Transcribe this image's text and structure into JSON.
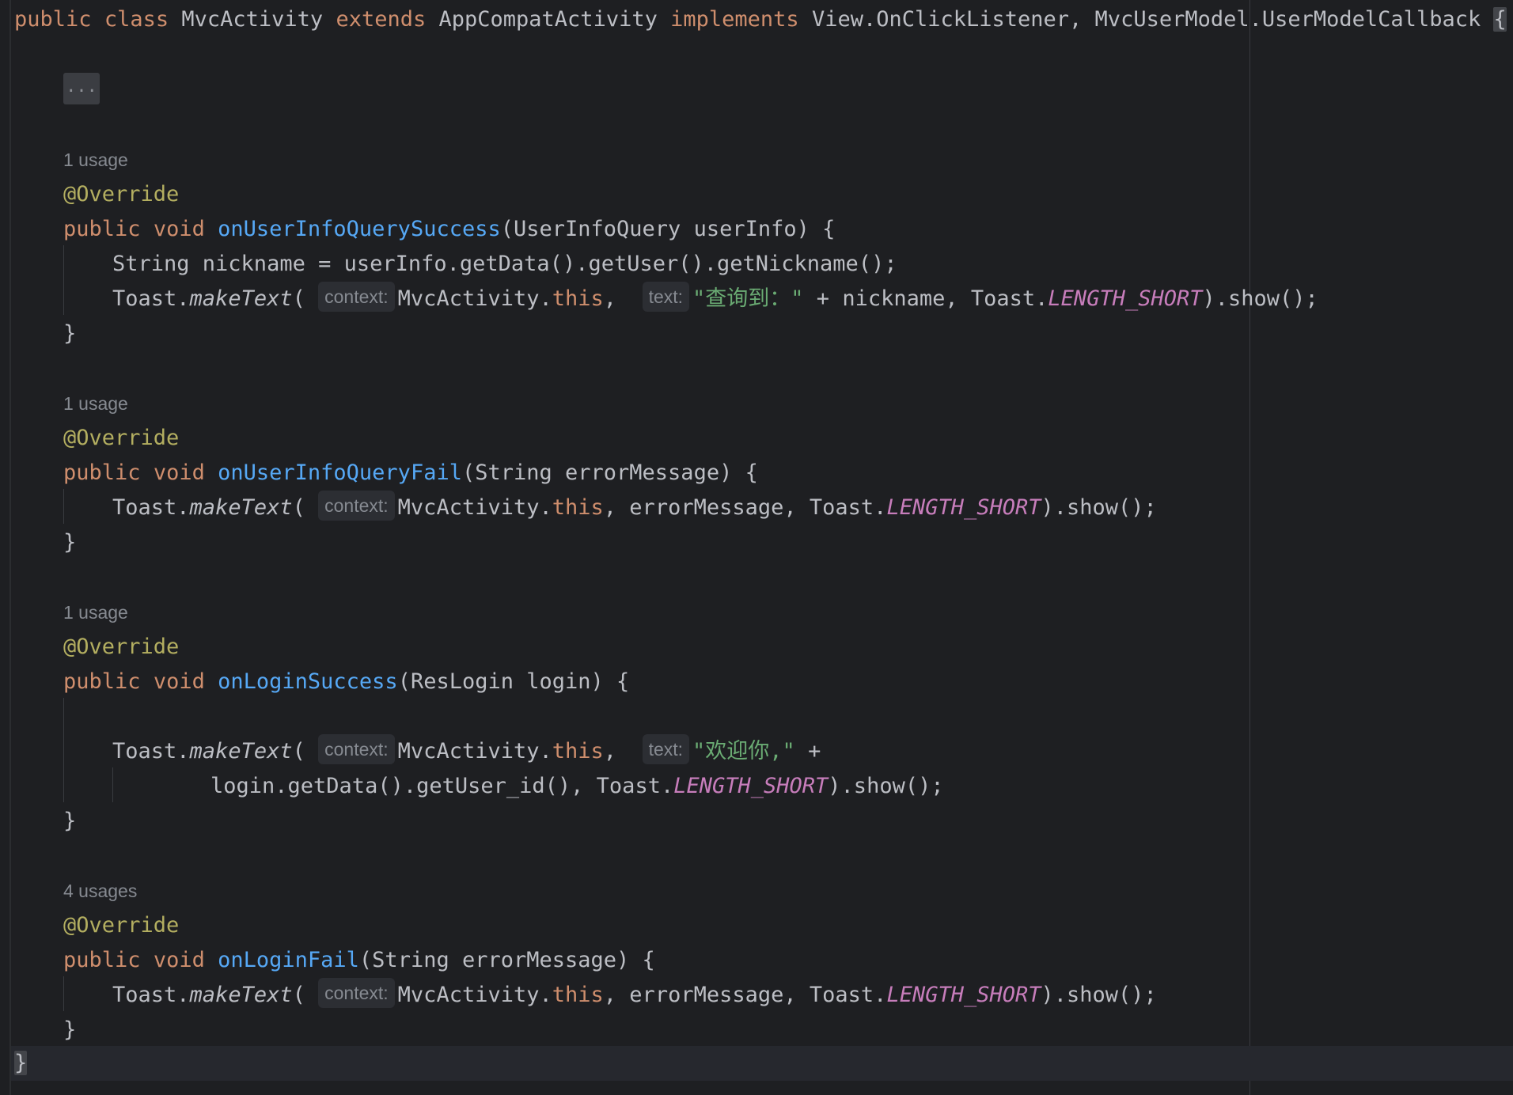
{
  "class_decl": {
    "kw_public": "public",
    "kw_class": "class",
    "class_name": "MvcActivity",
    "kw_extends": "extends",
    "super_class": "AppCompatActivity",
    "kw_implements": "implements",
    "interfaces": "View.OnClickListener, MvcUserModel.UserModelCallback",
    "open_brace": "{"
  },
  "folded_region": "...",
  "common": {
    "override": "@Override",
    "kw_public": "public",
    "kw_void": "void",
    "close_brace": "}",
    "toast": "Toast.",
    "make_text": "makeText",
    "open_paren": "(",
    "hint_context": "context:",
    "hint_text": "text:",
    "activity": "MvcActivity.",
    "kw_this": "this",
    "comma": ",",
    "toast_dot": "Toast.",
    "length_short": "LENGTH_SHORT",
    "show": ").show();"
  },
  "methods": [
    {
      "usage": "1 usage",
      "name": "onUserInfoQuerySuccess",
      "params": "(UserInfoQuery userInfo) {",
      "line1": "String nickname = userInfo.getData().getUser().getNickname();",
      "string_literal": "\"查询到：\"",
      "after_string": " + nickname, "
    },
    {
      "usage": "1 usage",
      "name": "onUserInfoQueryFail",
      "params": "(String errorMessage) {",
      "arg": " errorMessage, "
    },
    {
      "usage": "1 usage",
      "name": "onLoginSuccess",
      "params": "(ResLogin login) {",
      "string_literal": "\"欢迎你,\"",
      "after_string": " +",
      "continuation": "login.getData().getUser_id(), "
    },
    {
      "usage": "4 usages",
      "name": "onLoginFail",
      "params": "(String errorMessage) {",
      "arg": " errorMessage, "
    }
  ],
  "class_close": "}"
}
